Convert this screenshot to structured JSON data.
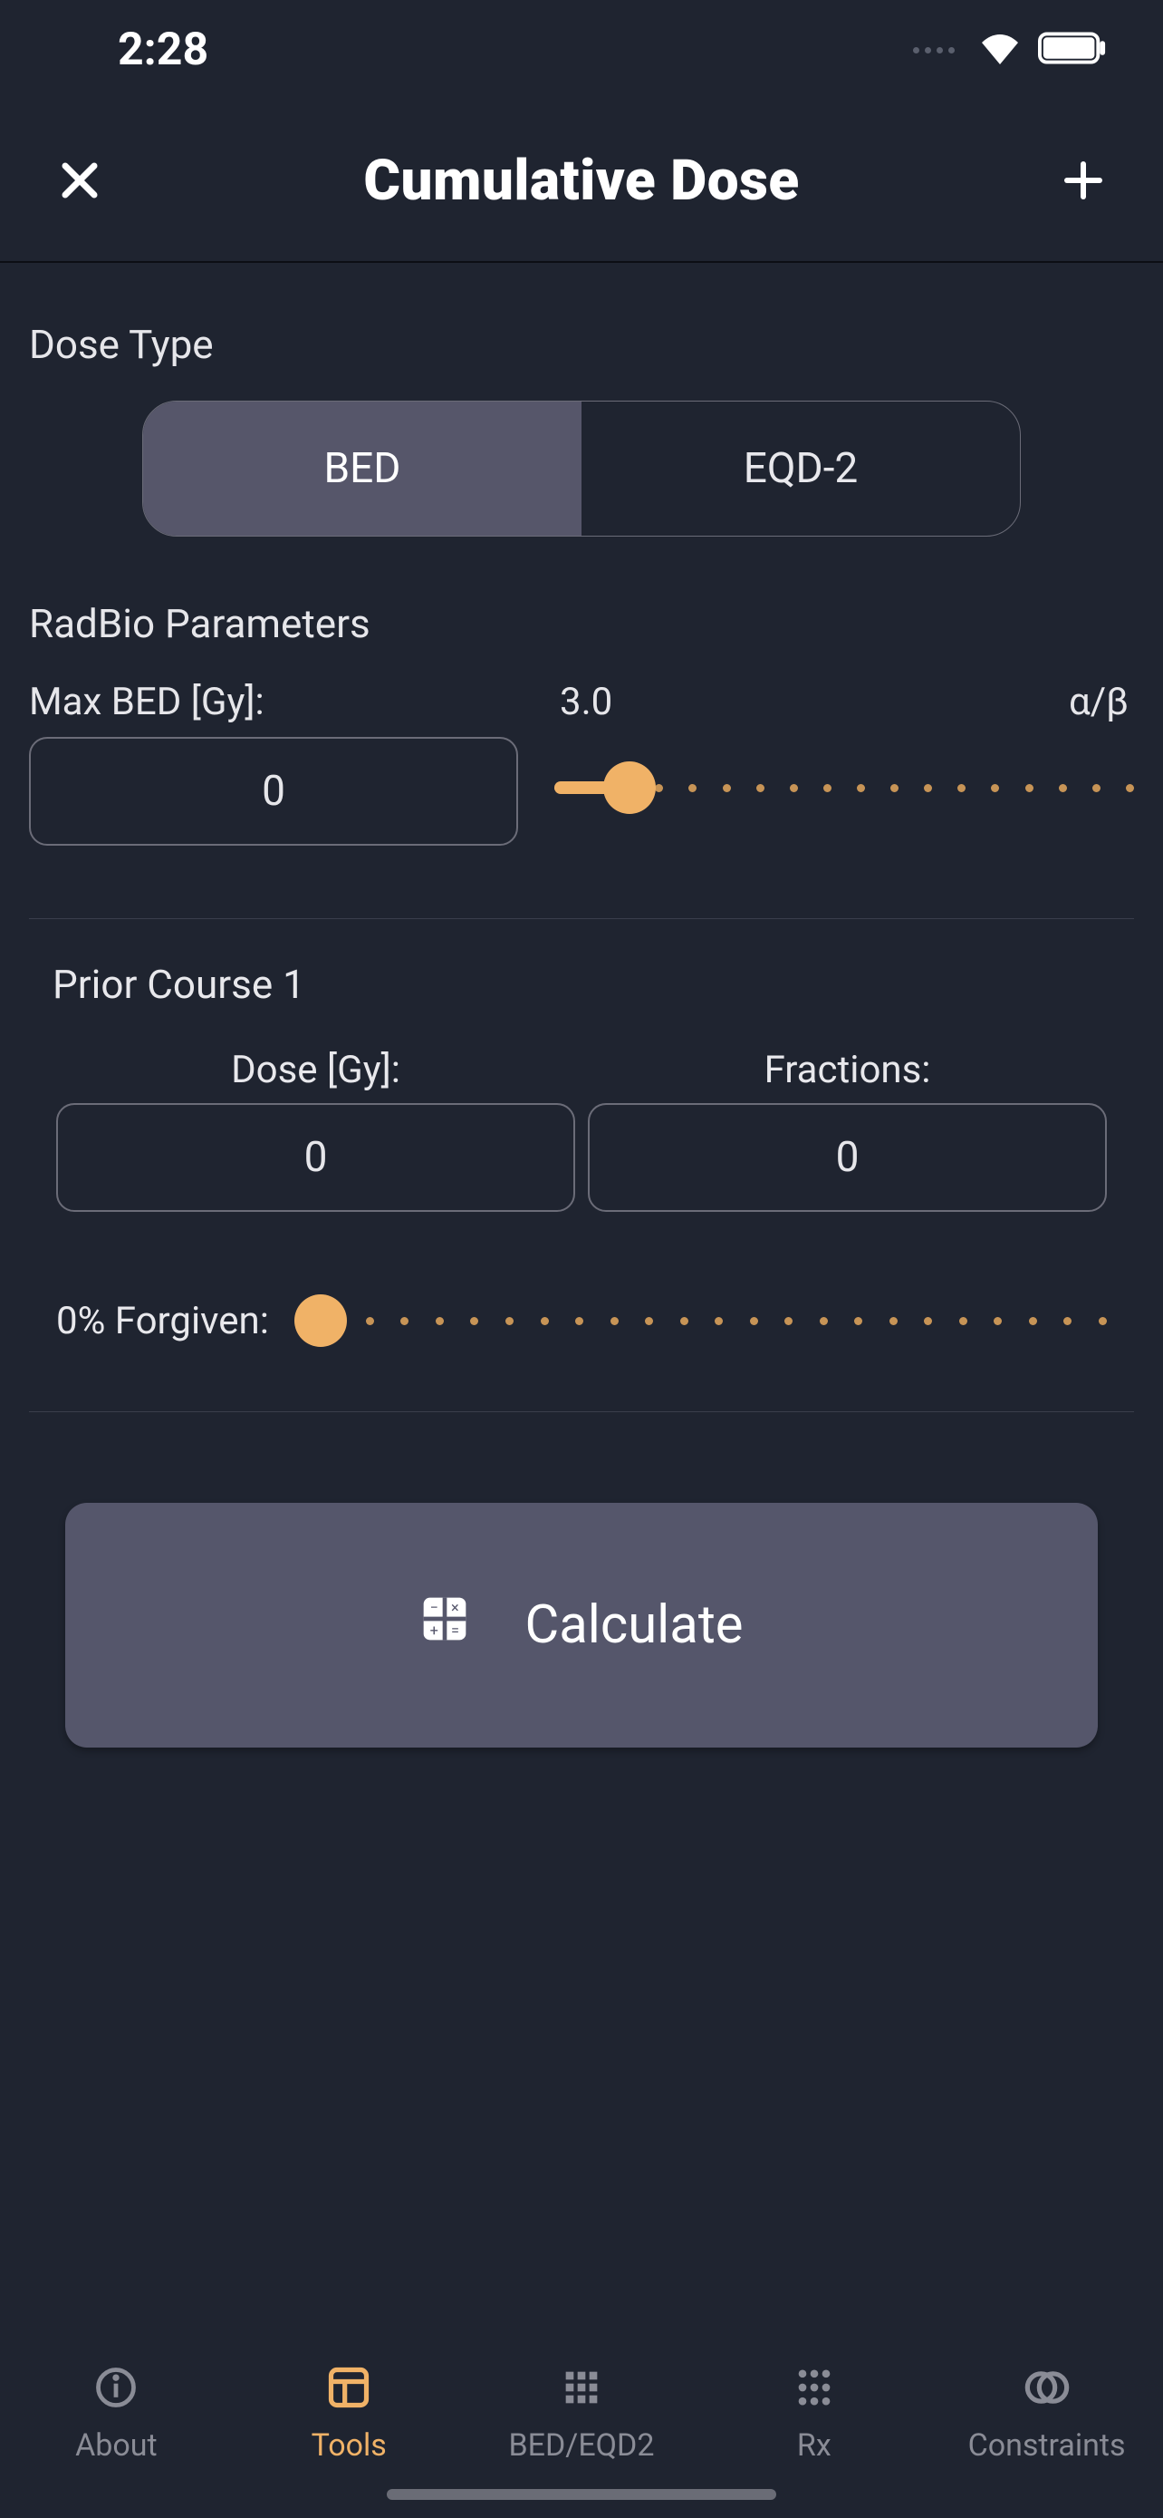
{
  "status": {
    "time": "2:28"
  },
  "header": {
    "title": "Cumulative Dose"
  },
  "dose_type": {
    "label": "Dose Type",
    "options": [
      "BED",
      "EQD-2"
    ],
    "selected": "BED"
  },
  "radbio": {
    "label": "RadBio Parameters",
    "max_bed_label": "Max BED [Gy]:",
    "max_bed_value": "0",
    "ab_value": "3.0",
    "ab_label": "α/β",
    "ab_slider_percent": 13
  },
  "course": {
    "title": "Prior Course 1",
    "dose_label": "Dose [Gy]:",
    "dose_value": "0",
    "fractions_label": "Fractions:",
    "fractions_value": "0",
    "forgiven_label": "0% Forgiven:",
    "forgiven_percent": 0
  },
  "calculate_label": "Calculate",
  "tabs": [
    {
      "label": "About"
    },
    {
      "label": "Tools"
    },
    {
      "label": "BED/EQD2"
    },
    {
      "label": "Rx"
    },
    {
      "label": "Constraints"
    }
  ],
  "active_tab_index": 1
}
